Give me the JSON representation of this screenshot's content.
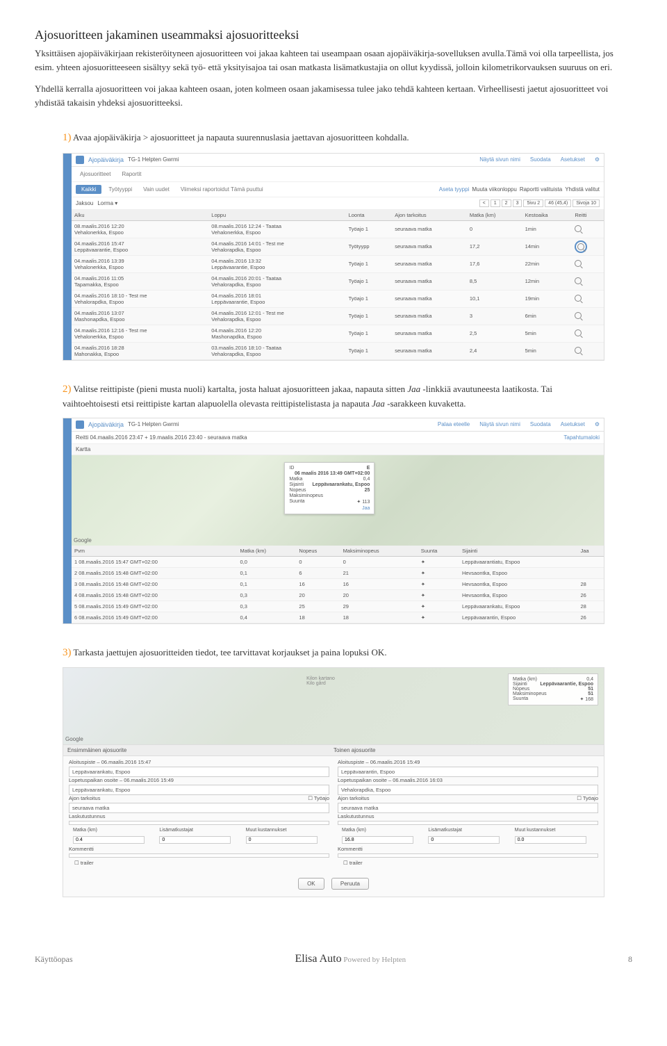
{
  "title": "Ajosuoritteen jakaminen useammaksi ajosuoritteeksi",
  "intro1": "Yksittäisen ajopäiväkirjaan rekisteröityneen ajosuoritteen voi jakaa kahteen tai useampaan osaan ajopäiväkirja-sovelluksen avulla.Tämä voi olla tarpeellista, jos esim. yhteen ajosuoritteeseen sisältyy sekä työ- että yksityisajoa tai osan matkasta lisämatkustajia on ollut kyydissä, jolloin kilometrikorvauksen suuruus on eri.",
  "intro2": "Yhdellä kerralla ajosuoritteen voi jakaa kahteen osaan, joten kolmeen osaan jakamisessa tulee jako tehdä kahteen kertaan. Virheellisesti jaetut ajosuoritteet voi yhdistää takaisin yhdeksi ajosuoritteeksi.",
  "step1_num": "1)",
  "step1_text": " Avaa ajopäiväkirja > ajosuoritteet ja napauta suurennuslasia jaettavan ajosuoritteen kohdalla.",
  "step2_num": "2)",
  "step2_text_a": " Valitse reittipiste (pieni musta nuoli) kartalta, josta haluat ajosuoritteen jakaa, napauta sitten ",
  "step2_link1": "Jaa",
  "step2_text_b": " -linkkiä avautuneesta laatikosta. Tai vaihtoehtoisesti etsi reittipiste kartan alapuolella olevasta reittipistelistasta ja napauta ",
  "step2_link2": "Jaa",
  "step2_text_c": " -sarakkeen kuvaketta.",
  "step3_num": "3)",
  "step3_text": " Tarkasta jaettujen ajosuoritteiden tiedot, tee tarvittavat korjaukset ja paina lopuksi OK.",
  "ss1": {
    "app": "Ajopäiväkirja",
    "vehicle": "TG-1 Helpten Gwrmi",
    "hlinks": [
      "Näytä sivun nimi",
      "Suodata",
      "Asetukset"
    ],
    "tabs": [
      "Ajosuoritteet",
      "Raportit"
    ],
    "subtabs": [
      "Kaikki",
      "Työtyyppi",
      "Vain uudet",
      "Viimeksi raportoidut Tämä puuttui"
    ],
    "rightlinks": [
      "Aseta tyyppi",
      "Muuta viikonloppu",
      "Raportti valituista",
      "Yhdistä valitut"
    ],
    "pager": [
      "<",
      "1",
      "2",
      "3",
      "5ivu 2",
      "46 (45,4)",
      "Sivoja 10"
    ],
    "headers": [
      "Alku",
      "Loppu",
      "Loonta",
      "Ajon tarkoitus",
      "Matka (km)",
      "Kestoaika",
      "Reitti"
    ],
    "rows": [
      {
        "a": "08.maalis.2016 12:20\nVehalonerkka, Espoo",
        "b": "08.maalis.2016 12:24 - Taataa\nVehalonerkka, Espoo",
        "c": "Työajo 1",
        "d": "seuraava matka",
        "e": "0",
        "f": "1min",
        "g": ""
      },
      {
        "a": "04.maalis.2016 15:47\nLeppävaarantie, Espoo",
        "b": "04.maalis.2016 14:01 - Test me\nVehalorapdka, Espoo",
        "c": "Työtyypp",
        "d": "seuraava matka",
        "e": "17,2",
        "f": "14min",
        "g": "highlight"
      },
      {
        "a": "04.maalis.2016 13:39\nVehalonerkka, Espoo",
        "b": "04.maalis.2016 13:32\nLeppävaarantie, Espoo",
        "c": "Työajo 1",
        "d": "seuraava matka",
        "e": "17,6",
        "f": "22min",
        "g": ""
      },
      {
        "a": "04.maalis.2016 11:05\nTapamakka, Espoo",
        "b": "04.maalis.2016 20:01 - Taataa\nVehalorapdka, Espoo",
        "c": "Työajo 1",
        "d": "seuraava matka",
        "e": "8,5",
        "f": "12min",
        "g": ""
      },
      {
        "a": "04.maalis.2016 18:10 - Test me\nVehalorapdka, Espoo",
        "b": "04.maalis.2016 18:01\nLeppävaarantie, Espoo",
        "c": "Työajo 1",
        "d": "seuraava matka",
        "e": "10,1",
        "f": "19min",
        "g": ""
      },
      {
        "a": "04.maalis.2016 13:07\nMashonapdka, Espoo",
        "b": "04.maalis.2016 12:01 - Test me\nVehalorapdka, Espoo",
        "c": "Työajo 1",
        "d": "seuraava matka",
        "e": "3",
        "f": "6min",
        "g": ""
      },
      {
        "a": "04.maalis.2016 12:16 - Test me\nVehalonerkka, Espoo",
        "b": "04.maalis.2016 12:20\nMashonapdka, Espoo",
        "c": "Työajo 1",
        "d": "seuraava matka",
        "e": "2,5",
        "f": "5min",
        "g": ""
      },
      {
        "a": "04.maalis.2016 18:28\nMahonakka, Espoo",
        "b": "03.maalis.2016 18:10 - Taataa\nVehalorapdka, Espoo",
        "c": "Työajo 1",
        "d": "seuraava matka",
        "e": "2,4",
        "f": "5min",
        "g": ""
      }
    ]
  },
  "ss2": {
    "app": "Ajopäiväkirja",
    "vehicle": "TG-1 Helpten Gwrmi",
    "hlinks": [
      "Palaa eteelle",
      "Näytä sivun nimi",
      "Suodata",
      "Asetukset"
    ],
    "reitti": "Reitti  04.maalis.2016 23:47 + 19.maalis.2016 23:40 - seuraava matka",
    "replink": "Tapahtumaloki",
    "kartta": "Kartta",
    "popup": {
      "id": "E",
      "date": "06 maalis 2016 13:49 GMT+02:00",
      "matka_label": "Matka",
      "matka": "0,4",
      "sij_label": "Sijainti",
      "sij": "Leppävaarankatu, Espoo",
      "nop_label": "Nopeus",
      "nop": "25",
      "max_label": "Maksiminopeus",
      "suunta_label": "Suunta",
      "suunta": "✦ 113",
      "jaa": "Jaa"
    },
    "google": "Google",
    "headers2": [
      "Pvm",
      "Matka (km)",
      "Nopeus",
      "Maksiminopeus",
      "Suunta",
      "Sijainti",
      "Jaa"
    ],
    "rows2": [
      {
        "a": "1  08.maalis.2016 15:47 GMT+02:00",
        "b": "0,0",
        "c": "0",
        "d": "0",
        "e": "✦",
        "f": "Leppävaarantiatu, Espoo",
        "g": ""
      },
      {
        "a": "2  08.maalis.2016 15:48 GMT+02:00",
        "b": "0,1",
        "c": "6",
        "d": "21",
        "e": "✦",
        "f": "Hevsaontka, Espoo",
        "g": ""
      },
      {
        "a": "3  08.maalis.2016 15:48 GMT+02:00",
        "b": "0,1",
        "c": "16",
        "d": "16",
        "e": "✦",
        "f": "Hevsaontka, Espoo",
        "g": "28"
      },
      {
        "a": "4  08.maalis.2016 15:48 GMT+02:00",
        "b": "0,3",
        "c": "20",
        "d": "20",
        "e": "✦",
        "f": "Hevsaontka, Espoo",
        "g": "26"
      },
      {
        "a": "5  08.maalis.2016 15:49 GMT+02:00",
        "b": "0,3",
        "c": "25",
        "d": "29",
        "e": "✦",
        "f": "Leppävaarankatu, Espoo",
        "g": "28"
      },
      {
        "a": "6  08.maalis.2016 15:49 GMT+02:00",
        "b": "0,4",
        "c": "18",
        "d": "18",
        "e": "✦",
        "f": "Leppävaarantin, Espoo",
        "g": "26"
      }
    ]
  },
  "ss3": {
    "maplabel1": "Kilon kartano",
    "maplabel2": "Kilo gård",
    "google": "Google",
    "info": {
      "matka_l": "Matka (km)",
      "matka": "0,4",
      "sij_l": "Sijainti",
      "sij": "Leppävaarantie, Espoo",
      "nop_l": "Nopeus",
      "nop": "51",
      "max_l": "Maksiminopeus",
      "max": "51",
      "suunta_l": "Suunta",
      "suunta": "✦ 168"
    },
    "sec1": "Ensimmäinen ajosuorite",
    "sec2": "Toinen ajosuorite",
    "l_aloitus_l": "Aloituspiste – 06.maalis.2016 15:47",
    "l_aloitus_v": "Leppävaarankatu, Espoo",
    "l_lopetus_l": "Lopetuspaikan osoite – 06.maalis.2016 15:49",
    "l_lopetus_v": "Leppävaarankatu, Espoo",
    "r_aloitus_l": "Aloituspiste – 06.maalis.2016 15:49",
    "r_aloitus_v": "Leppävaarantin, Espoo",
    "r_lopetus_l": "Lopetuspaikan osoite – 06.maalis.2016 16:03",
    "r_lopetus_v": "Vehalorapdka, Espoo",
    "tark_l": "Ajon tarkoitus",
    "tark_v": "seuraava matka",
    "tyoajo": "Työajo",
    "lasku_l": "Laskutustunnus",
    "costh": [
      "Matka (km)",
      "Lisämatkustajat",
      "Muut kustannukset"
    ],
    "l_costs": [
      "0.4",
      "0",
      "0"
    ],
    "r_costs": [
      "16.8",
      "0",
      "0.0"
    ],
    "kom": "Kommentti",
    "trailer": "trailer",
    "ok": "OK",
    "peruuta": "Peruuta"
  },
  "footer": {
    "left": "Käyttöopas",
    "brand": "Elisa Auto",
    "sub": " Powered by Helpten",
    "page": "8"
  }
}
